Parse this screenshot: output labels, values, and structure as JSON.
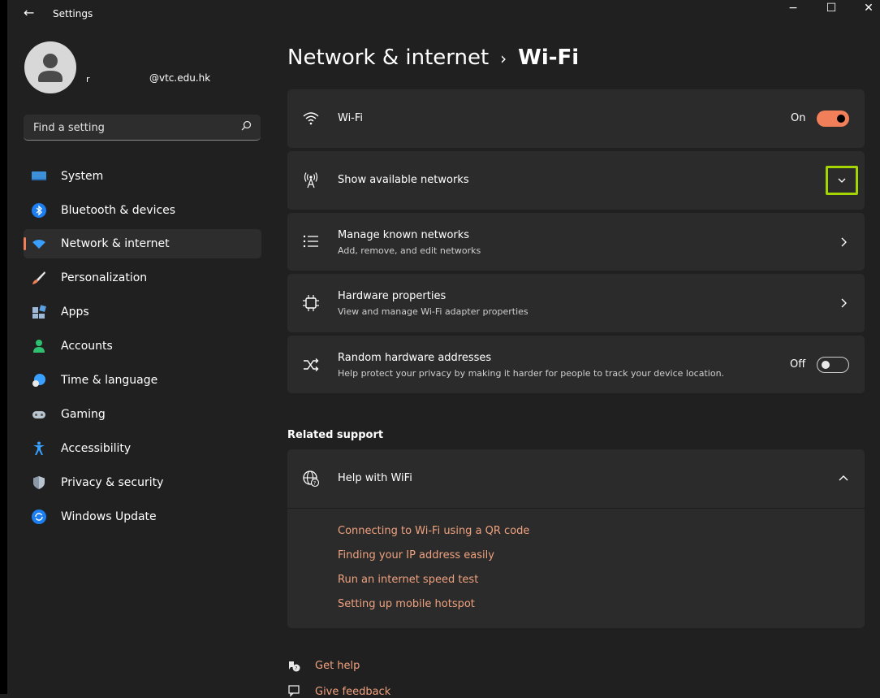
{
  "window": {
    "title": "Settings",
    "back_glyph": "←",
    "min_glyph": "−",
    "max_glyph": "☐",
    "close_glyph": "✕"
  },
  "user": {
    "name": "r",
    "email": "@vtc.edu.hk"
  },
  "search": {
    "placeholder": "Find a setting"
  },
  "sidebar": {
    "items": [
      {
        "label": "System",
        "icon": "monitor-icon"
      },
      {
        "label": "Bluetooth & devices",
        "icon": "bluetooth-icon"
      },
      {
        "label": "Network & internet",
        "icon": "wifi-icon",
        "active": true
      },
      {
        "label": "Personalization",
        "icon": "brush-icon"
      },
      {
        "label": "Apps",
        "icon": "apps-icon"
      },
      {
        "label": "Accounts",
        "icon": "person-icon"
      },
      {
        "label": "Time & language",
        "icon": "globe-clock-icon"
      },
      {
        "label": "Gaming",
        "icon": "gamepad-icon"
      },
      {
        "label": "Accessibility",
        "icon": "accessibility-icon"
      },
      {
        "label": "Privacy & security",
        "icon": "shield-icon"
      },
      {
        "label": "Windows Update",
        "icon": "update-icon"
      }
    ]
  },
  "breadcrumb": {
    "parent": "Network & internet",
    "separator": "›",
    "current": "Wi-Fi"
  },
  "cards": {
    "wifi": {
      "title": "Wi-Fi",
      "state_label": "On",
      "on": true
    },
    "available": {
      "title": "Show available networks"
    },
    "known": {
      "title": "Manage known networks",
      "subtitle": "Add, remove, and edit networks"
    },
    "hardware": {
      "title": "Hardware properties",
      "subtitle": "View and manage Wi-Fi adapter properties"
    },
    "random": {
      "title": "Random hardware addresses",
      "subtitle": "Help protect your privacy by making it harder for people to track your device location.",
      "state_label": "Off",
      "on": false
    }
  },
  "related": {
    "heading": "Related support",
    "help_title": "Help with WiFi",
    "links": [
      "Connecting to Wi-Fi using a QR code",
      "Finding your IP address easily",
      "Run an internet speed test",
      "Setting up mobile hotspot"
    ]
  },
  "footer": {
    "get_help": "Get help",
    "give_feedback": "Give feedback"
  },
  "colors": {
    "accent": "#f1805a",
    "link": "#f0a27f",
    "highlight": "#a5d500",
    "card_bg": "#2b2b2b",
    "page_bg": "#202020"
  }
}
